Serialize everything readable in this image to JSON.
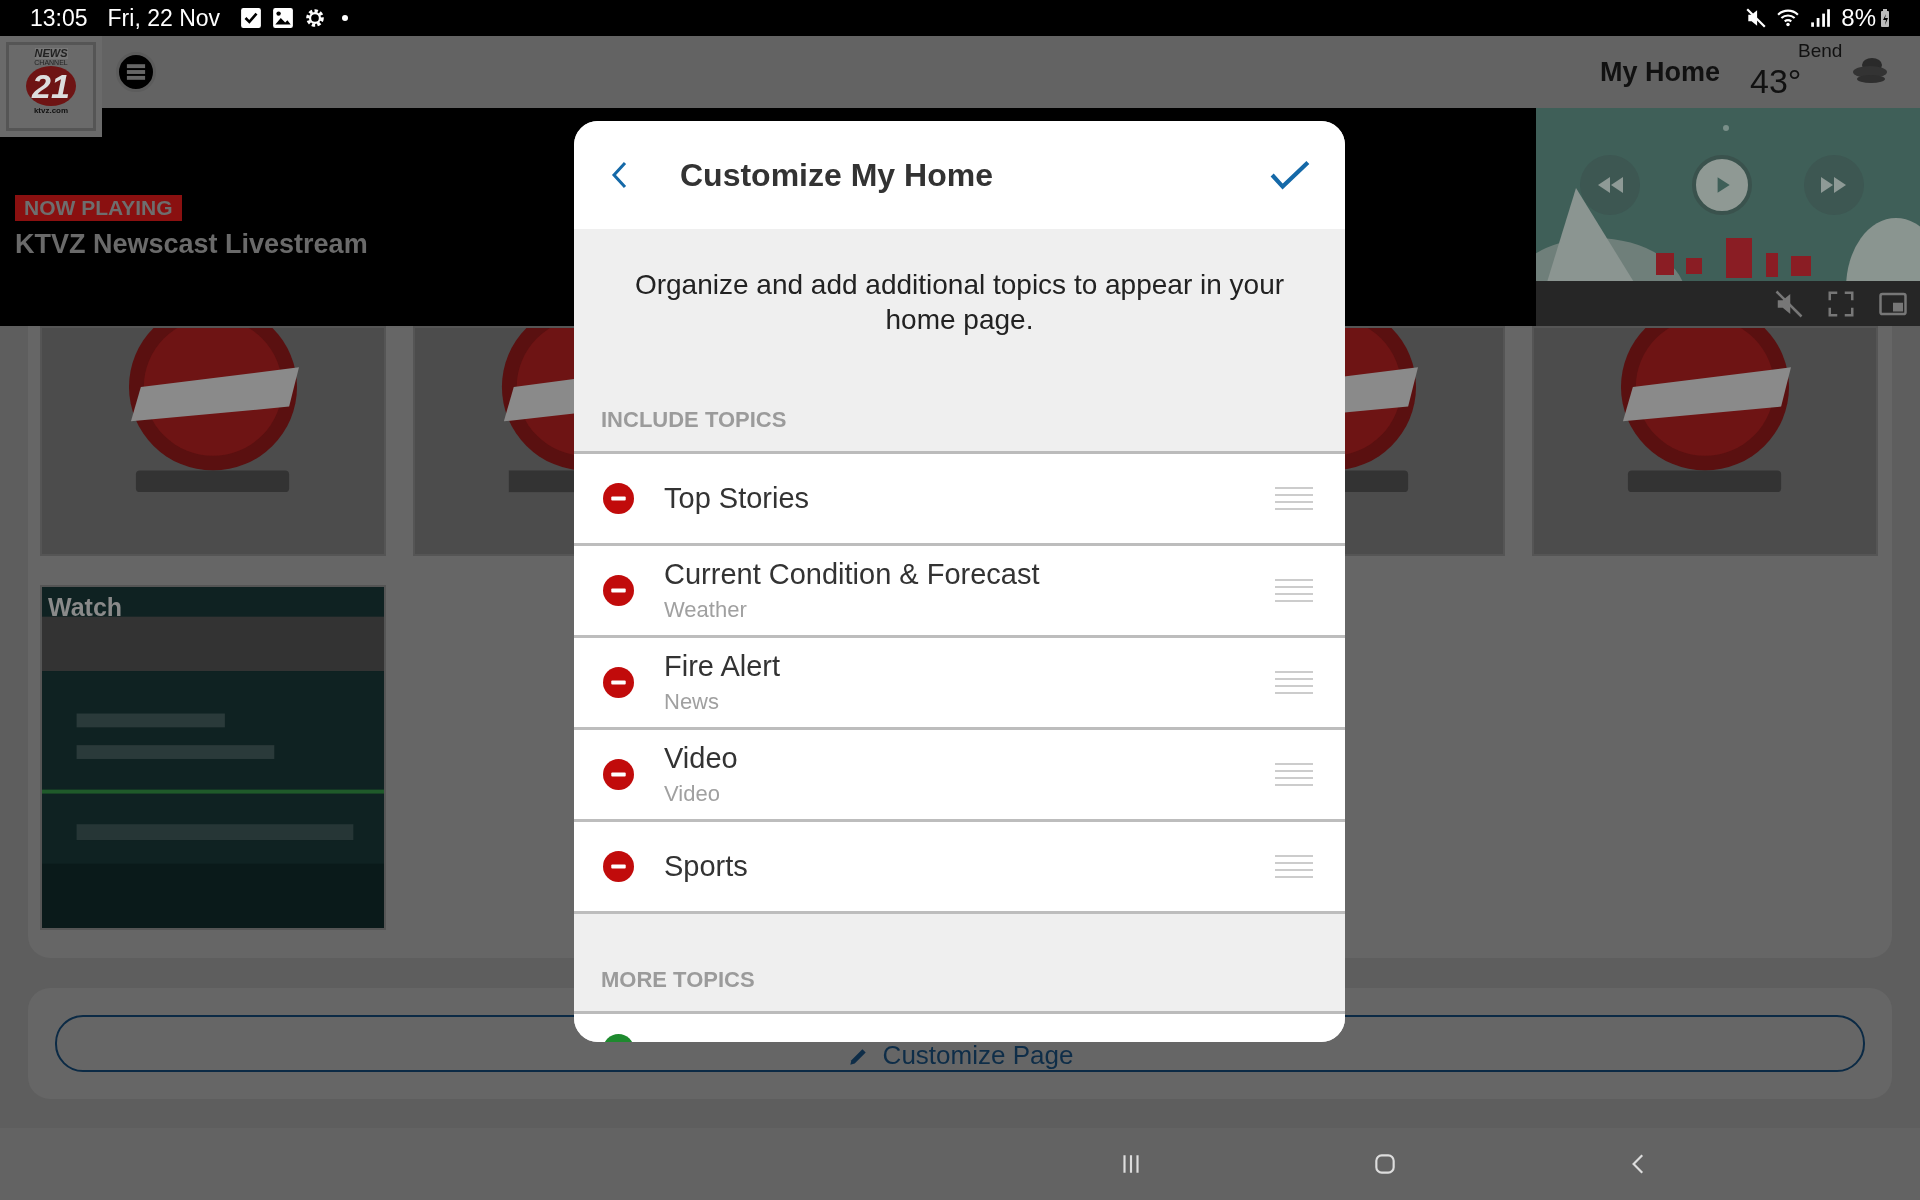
{
  "status_bar": {
    "time": "13:05",
    "date": "Fri, 22 Nov",
    "battery": "8%"
  },
  "header": {
    "logo": {
      "line_1": "NEWS",
      "line_2": "CHANNEL",
      "number": "21",
      "site": "ktvz.com"
    },
    "title": "My Home",
    "city": "Bend",
    "temperature": "43°"
  },
  "now_playing": {
    "badge": "NOW PLAYING",
    "title": "KTVZ Newscast Livestream"
  },
  "tiles": [
    {
      "kind": "picture"
    },
    {
      "kind": "partial"
    },
    {
      "kind": "hidden"
    },
    {
      "kind": "picture"
    },
    {
      "kind": "picture"
    }
  ],
  "watch_card": {
    "label": "Watch"
  },
  "customize_button": {
    "label": "Customize Page"
  },
  "dialog": {
    "title": "Customize My Home",
    "description": "Organize and add additional topics to appear in your home page.",
    "sections": [
      {
        "label": "INCLUDE TOPICS",
        "topics": [
          {
            "kind": "remove",
            "title": "Top Stories"
          },
          {
            "kind": "remove",
            "title": "Current Condition & Forecast",
            "subtitle": "Weather"
          },
          {
            "kind": "remove",
            "title": "Fire Alert",
            "subtitle": "News"
          },
          {
            "kind": "remove",
            "title": "Video",
            "subtitle": "Video"
          },
          {
            "kind": "remove",
            "title": "Sports"
          }
        ]
      },
      {
        "label": "MORE TOPICS",
        "topics": [
          {
            "kind": "add"
          }
        ]
      }
    ]
  }
}
